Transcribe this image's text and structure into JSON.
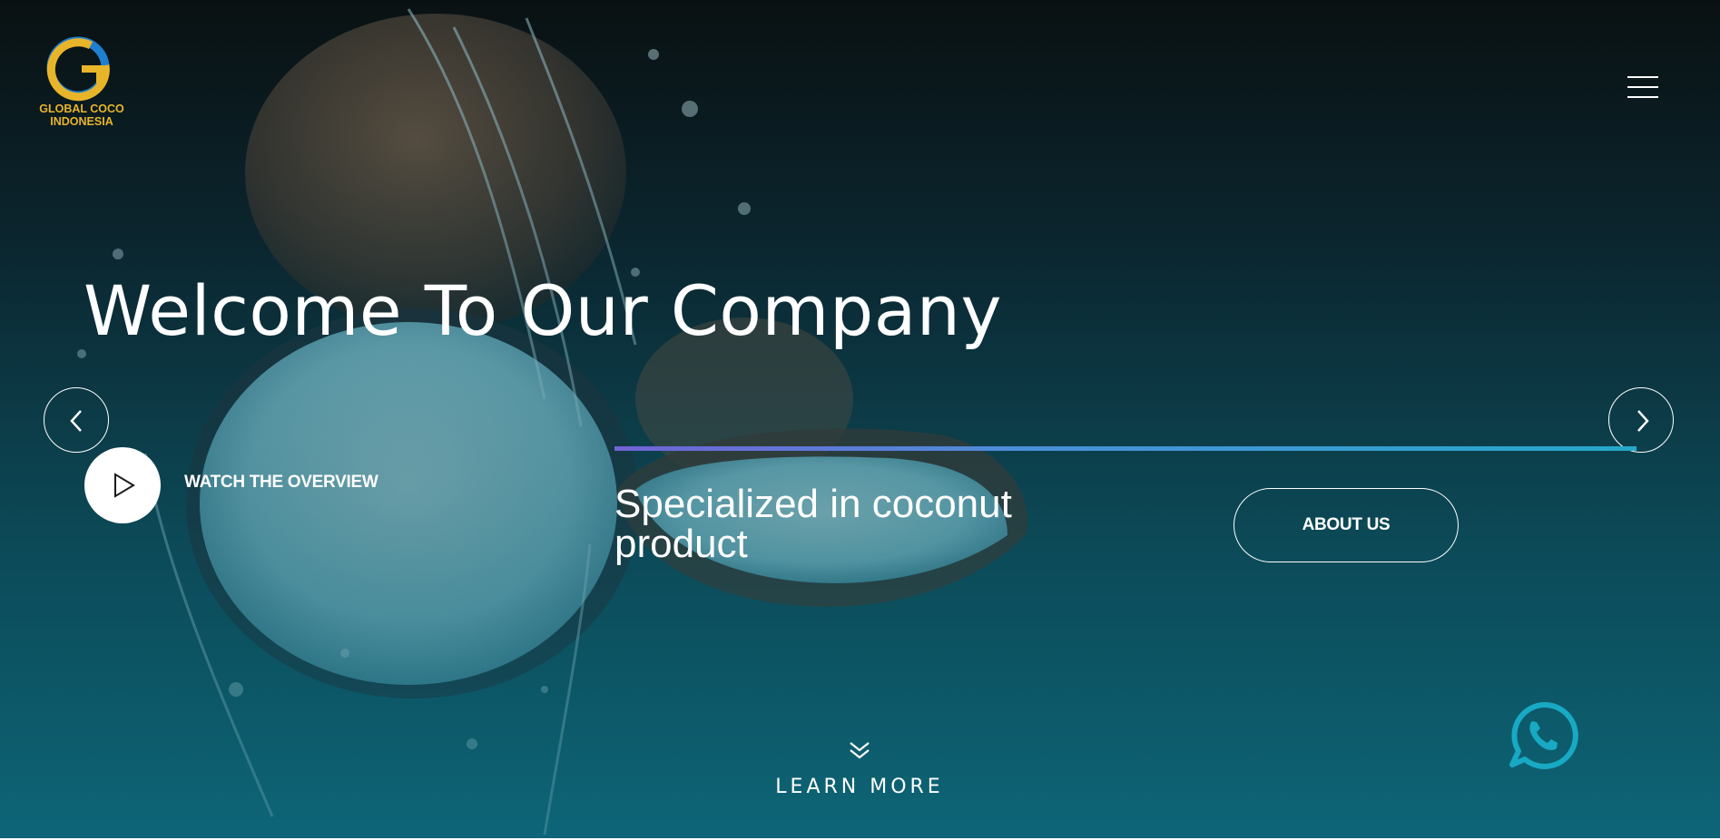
{
  "brand": {
    "logo_letter": "G",
    "logo_line1": "GLOBAL COCO",
    "logo_line2": "INDONESIA",
    "gold": "#e8b52a",
    "blue": "#1f7fd0"
  },
  "nav": {
    "menu_icon": "hamburger-menu-icon"
  },
  "hero": {
    "title": "Welcome To Our Company",
    "tagline": "Specialized in coconut product",
    "watch_label": "WATCH THE OVERVIEW",
    "about_label": "ABOUT US",
    "learn_more_label": "LEARN MORE",
    "prev_icon": "chevron-left-icon",
    "next_icon": "chevron-right-icon",
    "play_icon": "play-icon",
    "learn_more_icon": "double-chevron-down-icon",
    "progress_gradient": [
      "#7163d6",
      "#4b8fd9",
      "#25a9c9"
    ]
  },
  "floating": {
    "whatsapp_icon": "whatsapp-icon",
    "whatsapp_color": "#18a9c4"
  },
  "colors": {
    "background_top": "#0a1112",
    "background_bottom": "#0d6577"
  }
}
